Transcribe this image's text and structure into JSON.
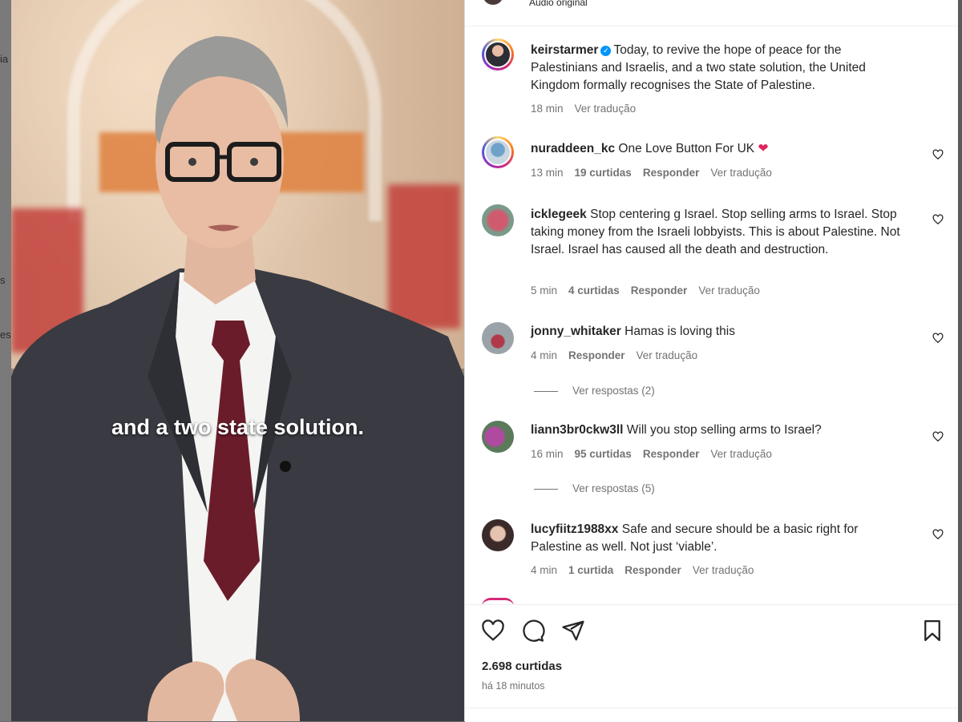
{
  "backdrop": {
    "fragments": [
      "ia",
      "s",
      "es"
    ]
  },
  "video": {
    "caption": "and a two state solution."
  },
  "top_strip": {
    "audio_label": "Áudio original"
  },
  "post": {
    "username": "keirstarmer",
    "verified": true,
    "caption": "Today, to revive the hope of peace for the Palestinians and Israelis, and a two state solution, the United Kingdom formally recognises the State of Palestine.",
    "time": "18 min",
    "translate": "Ver tradução"
  },
  "comments": [
    {
      "username": "nuraddeen_kc",
      "text": "One Love Button For UK",
      "emoji": "❤️",
      "time": "13 min",
      "likes": "19 curtidas",
      "reply": "Responder",
      "translate": "Ver tradução"
    },
    {
      "username": "icklegeek",
      "text": "Stop centering g Israel. Stop selling arms to Israel. Stop taking money from the Israeli lobbyists. This is about Palestine. Not Israel. Israel has caused all the death and destruction.",
      "time": "5 min",
      "likes": "4 curtidas",
      "reply": "Responder",
      "translate": "Ver tradução"
    },
    {
      "username": "jonny_whitaker",
      "text": "Hamas is loving this",
      "time": "4 min",
      "reply": "Responder",
      "translate": "Ver tradução",
      "view_replies": "Ver respostas (2)"
    },
    {
      "username": "liann3br0ckw3ll",
      "text": "Will you stop selling arms to Israel?",
      "time": "16 min",
      "likes": "95 curtidas",
      "reply": "Responder",
      "translate": "Ver tradução",
      "view_replies": "Ver respostas (5)"
    },
    {
      "username": "lucyfiitz1988xx",
      "text": "Safe and secure should be a basic right for Palestine as well. Not just ‘viable’.",
      "time": "4 min",
      "likes": "1 curtida",
      "reply": "Responder",
      "translate": "Ver tradução"
    }
  ],
  "actions": {
    "like_icon": "heart-icon",
    "comment_icon": "comment-icon",
    "share_icon": "paper-plane-icon",
    "save_icon": "bookmark-icon"
  },
  "stats": {
    "likes": "2.698 curtidas",
    "time_ago": "há 18 minutos"
  },
  "colors": {
    "accent_blue": "#0095f6",
    "heart_red": "#ed4956",
    "text": "#262626",
    "muted": "#737373"
  }
}
